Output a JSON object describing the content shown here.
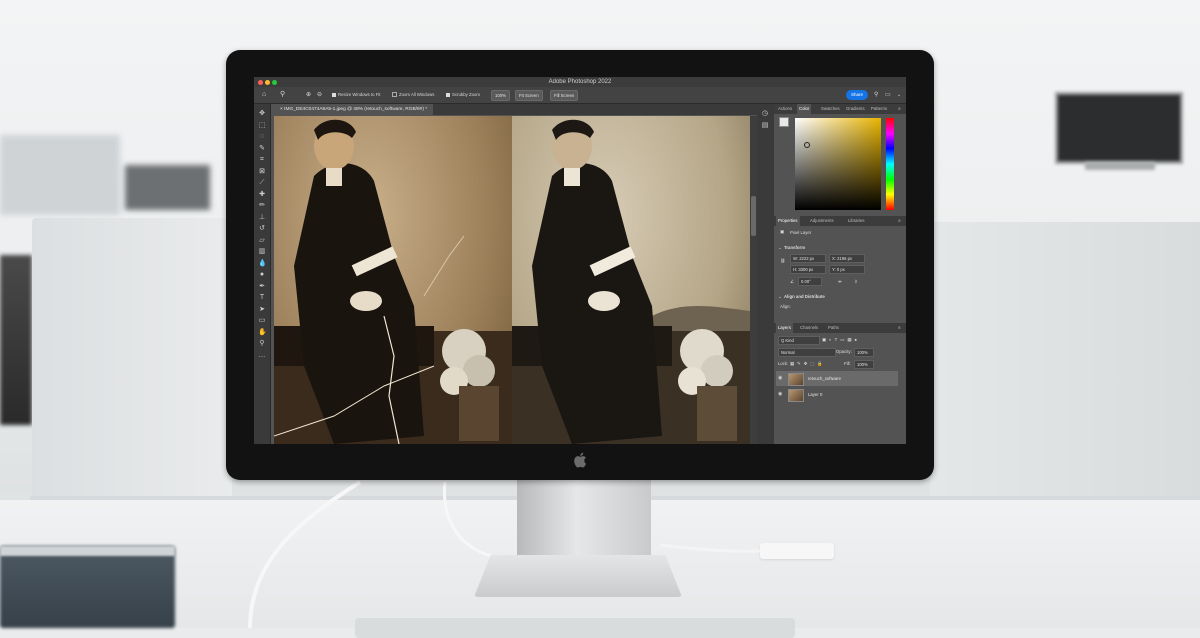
{
  "app": {
    "title": "Adobe Photoshop 2022",
    "colors": {
      "accent": "#1473e6",
      "chrome": "#3c3c3c",
      "panel": "#535353"
    }
  },
  "options_bar": {
    "resize_windows": "Resize Windows to Fit",
    "zoom_all": "Zoom All Windows",
    "scrubby_zoom": "Scrubby Zoom",
    "zoom_level": "100%",
    "fit_screen": "Fit Screen",
    "fill_screen": "Fill Screen",
    "share": "Share"
  },
  "document": {
    "tab_title": "IMG_DE4C0474A9A5-1.jpeg @ 48% (retouch_software, RGB/8#) *"
  },
  "tools": [
    "move-icon",
    "marquee-icon",
    "lasso-icon",
    "quick-select-icon",
    "crop-icon",
    "frame-icon",
    "eyedropper-icon",
    "healing-icon",
    "brush-icon",
    "stamp-icon",
    "history-brush-icon",
    "eraser-icon",
    "gradient-icon",
    "blur-icon",
    "dodge-icon",
    "pen-icon",
    "type-icon",
    "path-select-icon",
    "shape-icon",
    "hand-icon",
    "zoom-icon",
    "more-icon"
  ],
  "color_panel": {
    "tabs": [
      "Actions",
      "Color",
      "Swatches",
      "Gradients",
      "Patterns"
    ],
    "active": "Color",
    "hue": "#e8b400"
  },
  "properties_panel": {
    "tabs": [
      "Properties",
      "Adjustments",
      "Libraries"
    ],
    "layer_type": "Pixel Layer",
    "transform_label": "Transform",
    "w": "W: 2222 px",
    "x": "X: 2196 px",
    "h": "H: 3300 px",
    "y": "Y: 0 px",
    "angle": "0.00°",
    "align_label": "Align and Distribute",
    "align_sub": "Align:"
  },
  "layers_panel": {
    "tabs": [
      "Layers",
      "Channels",
      "Paths"
    ],
    "kind": "Q Kind",
    "blend_mode": "Normal",
    "opacity_label": "Opacity:",
    "opacity": "100%",
    "lock_label": "Lock:",
    "fill_label": "Fill:",
    "fill": "100%",
    "layers": [
      {
        "name": "retouch_software"
      },
      {
        "name": "Layer 0"
      }
    ]
  }
}
